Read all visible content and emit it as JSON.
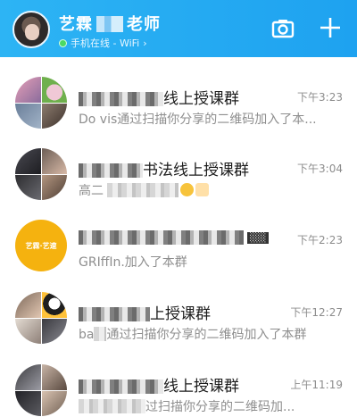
{
  "header": {
    "name_prefix": "艺霖",
    "name_suffix": "老师",
    "status": "手机在线 - WiFi",
    "chevron": "›",
    "icons": [
      "camera-icon",
      "plus-icon"
    ],
    "bg_color": "#1ea2f0",
    "online_color": "#4cd964"
  },
  "chats": [
    {
      "title": "线上授课群",
      "time": "下午3:23",
      "preview": "Do vis通过扫描你分享的二维码加入了本..."
    },
    {
      "title": "书法线上授课群",
      "time": "下午3:04",
      "preview_prefix": "高二"
    },
    {
      "avatar_logo": "艺霖·艺速",
      "time": "下午2:23",
      "preview": "GRIffIn.加入了本群"
    },
    {
      "title": "上授课群",
      "time": "下午12:27",
      "preview_prefix": "ba",
      "preview": "通过扫描你分享的二维码加入了本群"
    },
    {
      "title": "线上授课群",
      "time": "上午11:19",
      "preview": "过扫描你分享的二维码加..."
    }
  ]
}
